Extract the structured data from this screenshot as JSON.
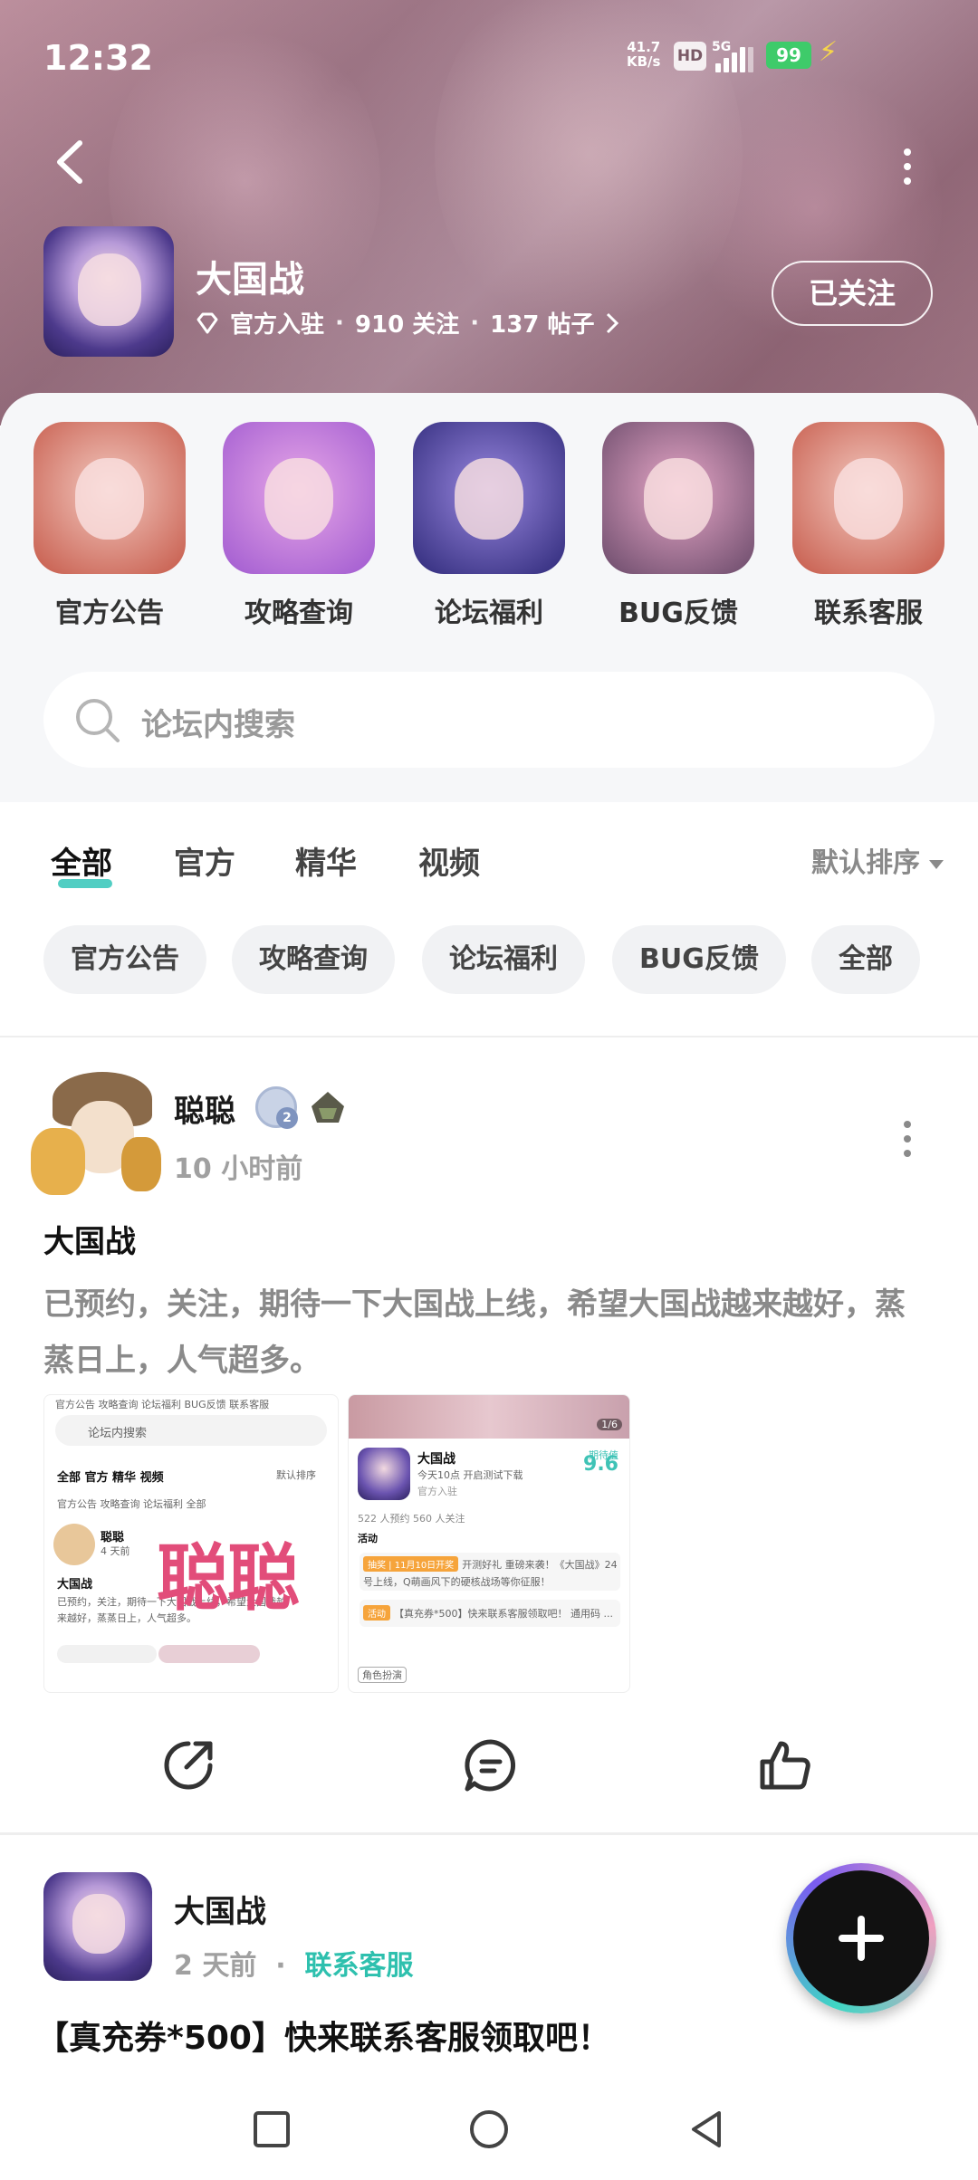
{
  "status_bar": {
    "time": "12:32",
    "net_speed": "41.7",
    "net_unit": "KB/s",
    "hd_label": "HD",
    "network": "5G",
    "battery": "99"
  },
  "forum": {
    "name": "大国战",
    "official_label": "官方入驻",
    "followers": "910 关注",
    "posts": "137 帖子",
    "follow_label": "已关注"
  },
  "shortcuts": [
    {
      "label": "官方公告",
      "colors": [
        "#f3c9c0",
        "#c65a4a"
      ]
    },
    {
      "label": "攻略查询",
      "colors": [
        "#e8a8e8",
        "#a05ad0"
      ]
    },
    {
      "label": "论坛福利",
      "colors": [
        "#9a88e0",
        "#2f2a7a"
      ]
    },
    {
      "label": "BUG反馈",
      "colors": [
        "#e8a8c8",
        "#6a4a6a"
      ]
    },
    {
      "label": "联系客服",
      "colors": [
        "#f3c9c0",
        "#c65a4a"
      ]
    }
  ],
  "search": {
    "placeholder": "论坛内搜索"
  },
  "tabs": [
    {
      "label": "全部",
      "active": true
    },
    {
      "label": "官方",
      "active": false
    },
    {
      "label": "精华",
      "active": false
    },
    {
      "label": "视频",
      "active": false
    }
  ],
  "sort_label": "默认排序",
  "chips": [
    "官方公告",
    "攻略查询",
    "论坛福利",
    "BUG反馈",
    "全部"
  ],
  "post1": {
    "user": "聪聪",
    "time": "10 小时前",
    "title": "大国战",
    "body": "已预约，关注，期待一下大国战上线，希望大国战越来越好，蒸蒸日上，人气超多。",
    "thumb1": {
      "top_tabs": "官方公告 攻略查询 论坛福利 BUG反馈 联系客服",
      "search": "论坛内搜索",
      "tabs": "全部 官方 精华 视频",
      "sort": "默认排序",
      "chips": "官方公告 攻略查询 论坛福利 全部",
      "user": "聪聪",
      "time": "4 天前",
      "title": "大国战",
      "body1": "已预约，关注，期待一下大国战上线，希望大国战越",
      "body2": "来越好，蒸蒸日上，人气超多。",
      "watermark": "聪聪"
    },
    "thumb2": {
      "page": "1/6",
      "name": "大国战",
      "subtitle": "今天10点 开启测试下载",
      "official": "官方入驻",
      "score_label": "期待值",
      "score": "9.6",
      "stats": "522 人预约    560 人关注",
      "activity": "活动",
      "row1_tag": "抽奖 | 11月10日开奖",
      "row1_text": "开测好礼 重磅来袭！《大国战》24",
      "row1_text2": "号上线，Q萌画风下的硬核战场等你征服！",
      "row2_tag": "活动",
      "row2_text": "【真充券*500】快来联系客服领取吧！ 通用码 ...",
      "chip": "角色扮演"
    }
  },
  "post2": {
    "user": "大国战",
    "time": "2 天前",
    "category": "联系客服",
    "title": "【真充券*500】快来联系客服领取吧！"
  },
  "colors": {
    "accent": "#2ec0ae",
    "text": "#1a1a1a",
    "muted": "#a0a0a0"
  }
}
